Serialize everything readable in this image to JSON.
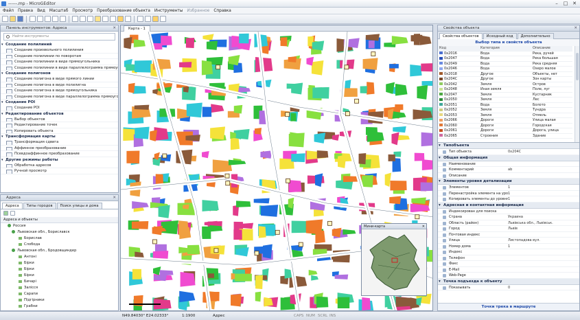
{
  "window": {
    "title": "------.mp - MicroGEditor"
  },
  "menu": [
    "Файл",
    "Правка",
    "Вид",
    "Масштаб",
    "Просмотр",
    "Преобразование объекта",
    "Инструменты",
    "Избранное",
    "Справка"
  ],
  "tools_panel": {
    "title": "Панель инструментов: Адреса",
    "search_placeholder": "Найти инструменты",
    "categories": [
      {
        "label": "Создание полилиний",
        "items": [
          "Создание произвольного полилиния",
          "Создание полилинии по поворотам",
          "Создание полилинии в виде прямоугольника",
          "Создание полилинии в виде параллелограмма прямоугольника"
        ]
      },
      {
        "label": "Создание полигонов",
        "items": [
          "Создание полигона в виде прямого линии",
          "Создание полигона в виде полилигна",
          "Создание полигона в виде прямоугольника",
          "Создание полигона в виде параллелограмма прямоугольника"
        ]
      },
      {
        "label": "Создание POI",
        "items": [
          "Создание POI"
        ]
      },
      {
        "label": "Редактирование объектов",
        "items": [
          "Выбор объектов",
          "Редактирование точек",
          "Копировать объекта"
        ]
      },
      {
        "label": "Трансформация карты",
        "items": [
          "Трансформация сдвига",
          "Аффинное преобразование",
          "Псевдоаффинное преобразование"
        ]
      },
      {
        "label": "Другие режимы работы",
        "items": [
          "Обработка адресов",
          "Ручной просмотр"
        ]
      }
    ]
  },
  "address_panel": {
    "title": "Адреса",
    "tabs": [
      "Адреса",
      "Типы городов",
      "Поиск улицы и дома"
    ],
    "tree_header": "Адреса и объекты",
    "tree": [
      "Россия",
      "Львовская обл., Бориславск",
      "Борислав",
      "Слобода",
      "Львовская обл., Бродовщиндер",
      "Антоні",
      "Бірки",
      "Бірки",
      "Бірки",
      "Бичарі",
      "Залісся",
      "Сарапи",
      "Підгірники",
      "Грабни"
    ]
  },
  "map": {
    "tab": "Карта - 1",
    "overview_title": "Мини-карта"
  },
  "right_panel": {
    "title": "Свойства объекта",
    "tabs": [
      "Свойства объектов",
      "Исходный код",
      "Дополнительно"
    ],
    "type_header": "Выбор типа и свойств объекта",
    "columns": [
      "Код",
      "Категория",
      "Описание"
    ],
    "types": [
      {
        "code": "0x2016",
        "cat": "Вода",
        "desc": "Река, ручей",
        "color": "#4a6fd0"
      },
      {
        "code": "0x2047",
        "cat": "Вода",
        "desc": "Река большая",
        "color": "#2a4fb8"
      },
      {
        "code": "0x2049",
        "cat": "Вода",
        "desc": "Река средняя",
        "color": "#6a8ae0"
      },
      {
        "code": "0x2046",
        "cat": "Вода",
        "desc": "Озеро малое",
        "color": "#8fa8ee"
      },
      {
        "code": "0x2018",
        "cat": "Другое",
        "desc": "Объекты, нет",
        "color": "#a05a2c"
      },
      {
        "code": "0x204C",
        "cat": "Другое",
        "desc": "Зон карты",
        "color": "#7a4a2a"
      },
      {
        "code": "0x2042",
        "cat": "Земля",
        "desc": "Остров",
        "color": "#8fcc60"
      },
      {
        "code": "0x2048",
        "cat": "Иная земля",
        "desc": "Поле, луг",
        "color": "#c8e090"
      },
      {
        "code": "0x2047",
        "cat": "Земля",
        "desc": "Кустарник",
        "color": "#4ea844"
      },
      {
        "code": "0x2050",
        "cat": "Земля",
        "desc": "Лес",
        "color": "#2d8a38"
      },
      {
        "code": "0x2051",
        "cat": "Вода",
        "desc": "Болото",
        "color": "#3fa89a"
      },
      {
        "code": "0x2052",
        "cat": "Земля",
        "desc": "Тундра",
        "color": "#cccc80"
      },
      {
        "code": "0x2053",
        "cat": "Земля",
        "desc": "Отмель",
        "color": "#e8d880"
      },
      {
        "code": "0x2066",
        "cat": "Дороги",
        "desc": "Улица малая",
        "color": "#f0a060"
      },
      {
        "code": "0x2060",
        "cat": "Дороги",
        "desc": "Городская",
        "color": "#e07838"
      },
      {
        "code": "0x2061",
        "cat": "Дороги",
        "desc": "Дорога, улица",
        "color": "#c85020"
      },
      {
        "code": "0x2065",
        "cat": "Строения",
        "desc": "Здание",
        "color": "#d06aa0"
      }
    ],
    "sections": [
      {
        "label": "Типобъекта",
        "rows": [
          [
            "Тип объекта",
            "0x204C"
          ]
        ]
      },
      {
        "label": "Общая информация",
        "rows": [
          [
            "Наименование",
            ""
          ],
          [
            "Комментарий",
            "ab"
          ],
          [
            "Описание",
            ""
          ]
        ]
      },
      {
        "label": "Элементы уровня детализации",
        "rows": [
          [
            "Элементов",
            "1"
          ],
          [
            "Перенастройка элемента на уровень",
            "1"
          ],
          [
            "Копировать элементы до уровня",
            "1"
          ]
        ]
      },
      {
        "label": "Адресная и контактная информация",
        "rows": [
          [
            "Индексирован для поиска",
            ""
          ],
          [
            "Страна",
            "Украина"
          ],
          [
            "Область (район)",
            "Львівська обл., Львівськ."
          ],
          [
            "Город",
            "Львів"
          ],
          [
            "Почтовая индекс",
            ""
          ],
          [
            "Улица",
            "Листопадова вул."
          ],
          [
            "Номер дома",
            "1"
          ],
          [
            "Индекс",
            ""
          ],
          [
            "Телефон",
            ""
          ],
          [
            "Факс",
            ""
          ],
          [
            "E-Mail",
            ""
          ],
          [
            "Web-Page",
            ""
          ]
        ]
      },
      {
        "label": "Точка подъезда к объекту",
        "rows": [
          [
            "Показывать",
            "0"
          ]
        ]
      }
    ],
    "footer_link": "Точки трека в маршруте"
  },
  "status": {
    "coords": "N49.84030° E24.02333°",
    "scale": "1:1900",
    "mode": "Адрес",
    "flags": [
      "CAPS",
      "NUM",
      "SCRL",
      "INS"
    ]
  }
}
